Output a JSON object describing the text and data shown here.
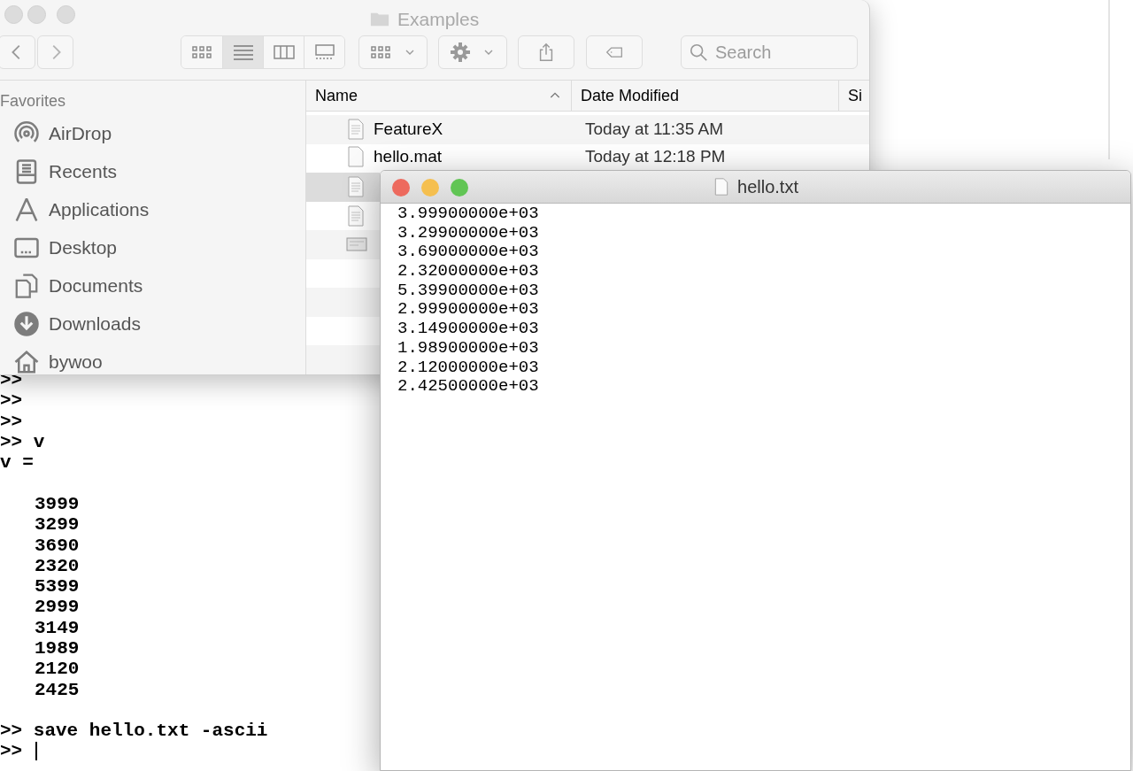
{
  "terminal": {
    "lines": [
      {
        "kind": "prompt",
        "text": ">>"
      },
      {
        "kind": "prompt",
        "text": ">>"
      },
      {
        "kind": "prompt",
        "text": ">>"
      },
      {
        "kind": "prompt",
        "text": ">> v"
      },
      {
        "kind": "output",
        "text": "v ="
      },
      {
        "kind": "blank"
      },
      {
        "kind": "value",
        "text": "3999"
      },
      {
        "kind": "value",
        "text": "3299"
      },
      {
        "kind": "value",
        "text": "3690"
      },
      {
        "kind": "value",
        "text": "2320"
      },
      {
        "kind": "value",
        "text": "5399"
      },
      {
        "kind": "value",
        "text": "2999"
      },
      {
        "kind": "value",
        "text": "3149"
      },
      {
        "kind": "value",
        "text": "1989"
      },
      {
        "kind": "value",
        "text": "2120"
      },
      {
        "kind": "value",
        "text": "2425"
      },
      {
        "kind": "blank"
      },
      {
        "kind": "prompt",
        "text": ">> save hello.txt -ascii"
      },
      {
        "kind": "cursor",
        "text": ">>"
      }
    ]
  },
  "finder": {
    "title": "Examples",
    "view_modes": [
      {
        "selected": false
      },
      {
        "selected": true
      },
      {
        "selected": false
      },
      {
        "selected": false
      }
    ],
    "search": {
      "placeholder": "Search"
    },
    "sidebar": {
      "heading": "Favorites",
      "items": [
        {
          "label": "AirDrop"
        },
        {
          "label": "Recents"
        },
        {
          "label": "Applications"
        },
        {
          "label": "Desktop"
        },
        {
          "label": "Documents"
        },
        {
          "label": "Downloads"
        },
        {
          "label": "bywoo"
        }
      ]
    },
    "columns": [
      {
        "label": "Name",
        "sorted": true
      },
      {
        "label": "Date Modified",
        "sorted": false
      },
      {
        "label": "Si",
        "sorted": false
      }
    ],
    "files": [
      {
        "name": "FeatureX",
        "date": "Today at 11:35 AM",
        "selected": false
      },
      {
        "name": "hello.mat",
        "date": "Today at 12:18 PM",
        "selected": false
      },
      {
        "selected": true
      },
      {
        "selected": false
      },
      {
        "selected": false
      }
    ]
  },
  "editor": {
    "title": "hello.txt",
    "lines": [
      "3.99900000e+03",
      "3.29900000e+03",
      "3.69000000e+03",
      "2.32000000e+03",
      "5.39900000e+03",
      "2.99900000e+03",
      "3.14900000e+03",
      "1.98900000e+03",
      "2.12000000e+03",
      "2.42500000e+03"
    ]
  }
}
